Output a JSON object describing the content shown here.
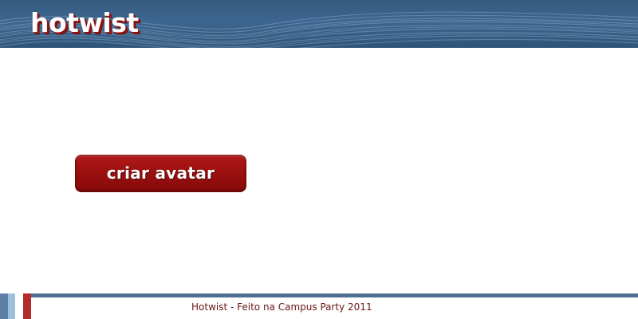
{
  "header": {
    "logo_text": "hotwist"
  },
  "main": {
    "create_avatar_label": "criar avatar"
  },
  "footer": {
    "text": "Hotwist - Feito na Campus Party 2011"
  },
  "colors": {
    "header_blue": "#3d6690",
    "button_red": "#9c1010",
    "footer_line": "#4e6f93",
    "footer_text": "#6a1414",
    "stripe_red": "#b52a2a",
    "stripe_light_blue": "#9fc0dd"
  }
}
